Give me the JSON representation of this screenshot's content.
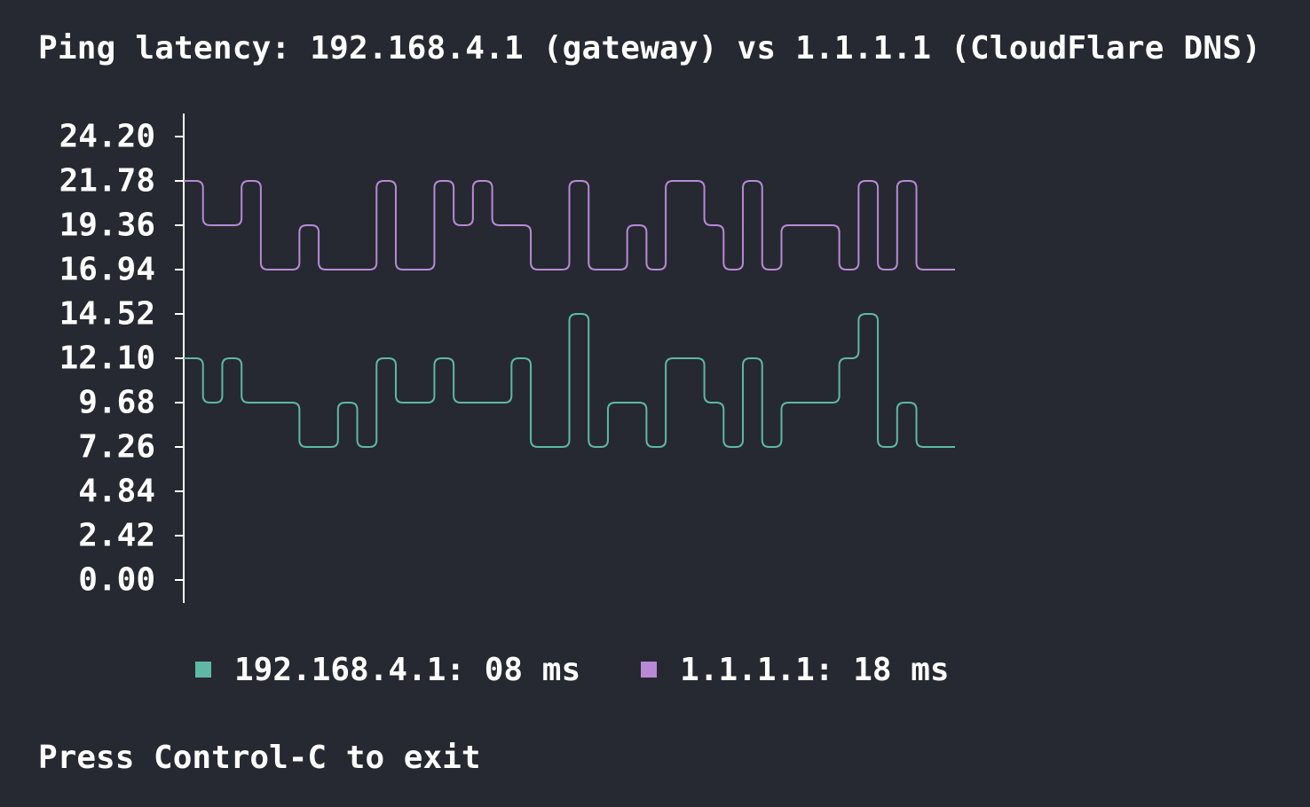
{
  "window": {
    "title": "Ping latency: 192.168.4.1 (gateway) vs 1.1.1.1 (CloudFlare DNS)",
    "footer": "Press Control-C to exit"
  },
  "legend": [
    {
      "label": "192.168.4.1: 08 ms",
      "color": "#5fb8a5"
    },
    {
      "label": "1.1.1.1: 18 ms",
      "color": "#b88ad6"
    }
  ],
  "chart_data": {
    "type": "line",
    "step": true,
    "ylim": [
      0,
      24.2
    ],
    "yticks": [
      "24.20",
      "21.78",
      "19.36",
      "16.94",
      "14.52",
      "12.10",
      "9.68",
      "7.26",
      "4.84",
      "2.42",
      "0.00"
    ],
    "series": [
      {
        "name": "192.168.4.1",
        "color": "#5fb8a5",
        "values": [
          12.1,
          9.68,
          12.1,
          9.68,
          9.68,
          9.68,
          7.26,
          7.26,
          9.68,
          7.26,
          12.1,
          9.68,
          9.68,
          12.1,
          9.68,
          9.68,
          9.68,
          12.1,
          7.26,
          7.26,
          14.52,
          7.26,
          9.68,
          9.68,
          7.26,
          12.1,
          12.1,
          9.68,
          7.26,
          12.1,
          7.26,
          9.68,
          9.68,
          9.68,
          12.1,
          14.52,
          7.26,
          9.68,
          7.26,
          7.26
        ]
      },
      {
        "name": "1.1.1.1",
        "color": "#b88ad6",
        "values": [
          21.78,
          19.36,
          19.36,
          21.78,
          16.94,
          16.94,
          19.36,
          16.94,
          16.94,
          16.94,
          21.78,
          16.94,
          16.94,
          21.78,
          19.36,
          21.78,
          19.36,
          19.36,
          16.94,
          16.94,
          21.78,
          16.94,
          16.94,
          19.36,
          16.94,
          21.78,
          21.78,
          19.36,
          16.94,
          21.78,
          16.94,
          19.36,
          19.36,
          19.36,
          16.94,
          21.78,
          16.94,
          21.78,
          16.94,
          16.94
        ]
      }
    ]
  }
}
